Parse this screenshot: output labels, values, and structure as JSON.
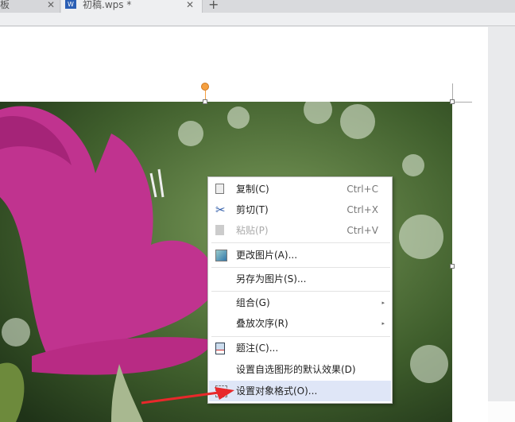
{
  "tabs": [
    {
      "label": "板",
      "close": "✕"
    },
    {
      "label": "初稿.wps *",
      "close": "✕"
    }
  ],
  "new_tab": "+",
  "menu": {
    "items": [
      {
        "label": "复制(C)",
        "shortcut": "Ctrl+C",
        "icon": "copy-icon"
      },
      {
        "label": "剪切(T)",
        "shortcut": "Ctrl+X",
        "icon": "scissors-icon"
      },
      {
        "label": "粘贴(P)",
        "shortcut": "Ctrl+V",
        "icon": "paste-icon",
        "disabled": true
      },
      {
        "label": "更改图片(A)...",
        "icon": "change-picture-icon"
      },
      {
        "label": "另存为图片(S)..."
      },
      {
        "label": "组合(G)",
        "submenu": "▸"
      },
      {
        "label": "叠放次序(R)",
        "submenu": "▸"
      },
      {
        "label": "题注(C)...",
        "icon": "caption-icon"
      },
      {
        "label": "设置自选图形的默认效果(D)"
      },
      {
        "label": "设置对象格式(O)...",
        "icon": "format-object-icon",
        "highlighted": true
      }
    ]
  },
  "colors": {
    "highlight": "#dfe6f7",
    "arrow": "#e8282b",
    "handle": "#f5a040"
  }
}
